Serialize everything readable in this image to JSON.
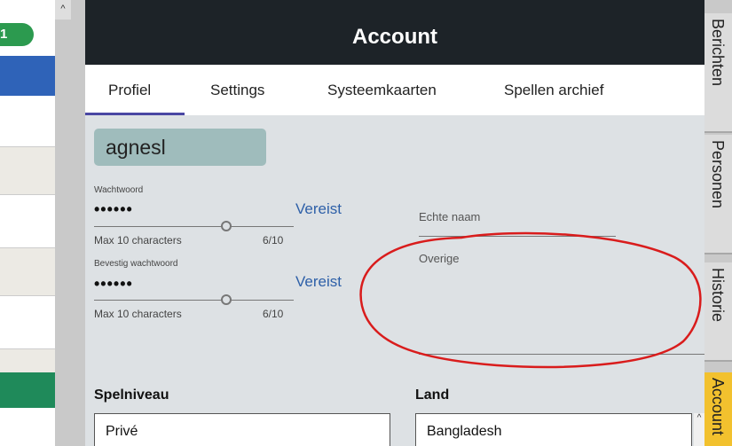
{
  "left_strip": {
    "badge": "1"
  },
  "scrollbar": {
    "up_arrow": "^"
  },
  "header": {
    "title": "Account"
  },
  "tabs": [
    {
      "label": "Profiel",
      "active": true
    },
    {
      "label": "Settings",
      "active": false
    },
    {
      "label": "Systeemkaarten",
      "active": false
    },
    {
      "label": "Spellen archief",
      "active": false
    }
  ],
  "profile": {
    "username": "agnesl",
    "password": {
      "label": "Wachtwoord",
      "value": "••••••",
      "hint": "Max 10 characters",
      "counter": "6/10",
      "required": "Vereist"
    },
    "confirm_password": {
      "label": "Bevestig wachtwoord",
      "value": "••••••",
      "hint": "Max 10 characters",
      "counter": "6/10",
      "required": "Vereist"
    },
    "real_name": {
      "label": "Echte naam",
      "value": ""
    },
    "other": {
      "label": "Overige",
      "value": ""
    },
    "skill_level": {
      "label": "Spelniveau",
      "value": "Privé"
    },
    "country": {
      "label": "Land",
      "value": "Bangladesh"
    }
  },
  "side_tabs": [
    {
      "label": "Berichten",
      "active": false
    },
    {
      "label": "Personen",
      "active": false
    },
    {
      "label": "Historie",
      "active": false
    },
    {
      "label": "Account",
      "active": true
    }
  ],
  "colors": {
    "header_bg": "#1d2328",
    "panel_bg": "#dde1e4",
    "tab_underline": "#4a47a3",
    "username_bg": "#9fbcbc",
    "required_text": "#2e60a8",
    "active_side_tab": "#f2c12e",
    "annotation_stroke": "#d91c1c",
    "badge_green": "#2c9a4f"
  }
}
